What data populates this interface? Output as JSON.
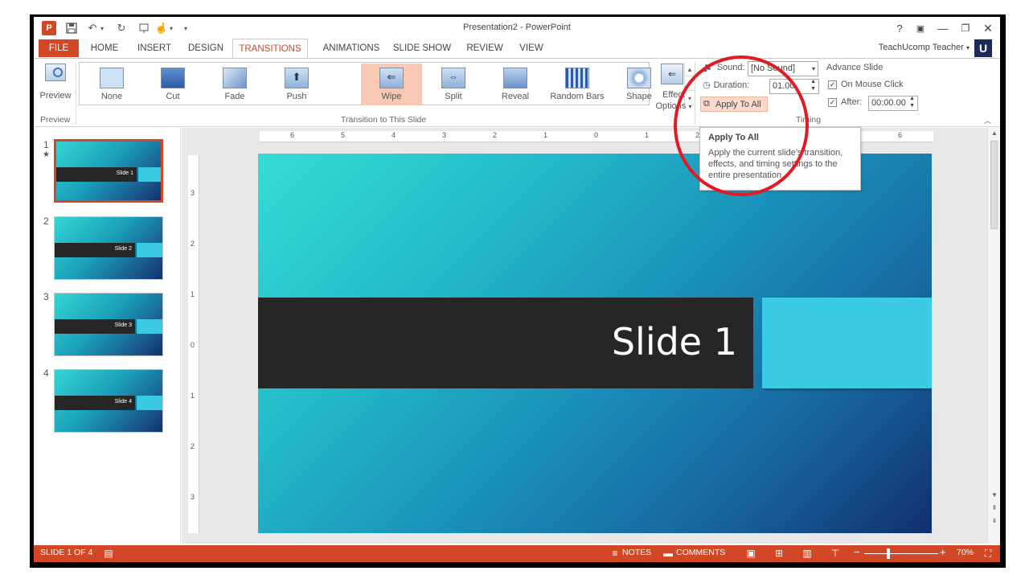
{
  "window": {
    "title": "Presentation2 - PowerPoint",
    "app_icon": "P",
    "controls": [
      "?",
      "▣",
      "—",
      "❐",
      "✕"
    ]
  },
  "quick_access": {
    "save": "save-icon",
    "undo": "undo-icon",
    "redo": "redo-icon",
    "start": "slideshow-icon",
    "touch": "touch-icon",
    "customize": "▾"
  },
  "tabs": [
    "FILE",
    "HOME",
    "INSERT",
    "DESIGN",
    "TRANSITIONS",
    "ANIMATIONS",
    "SLIDE SHOW",
    "REVIEW",
    "VIEW"
  ],
  "user": {
    "name": "TeachUcomp Teacher",
    "badge": "U"
  },
  "ribbon": {
    "preview": {
      "label": "Preview",
      "group": "Preview"
    },
    "transitions": {
      "items": [
        "None",
        "Cut",
        "Fade",
        "Push",
        "Wipe",
        "Split",
        "Reveal",
        "Random Bars",
        "Shape"
      ],
      "selected": "Wipe",
      "group": "Transition to This Slide"
    },
    "effect_options": {
      "line1": "Effect",
      "line2": "Options"
    },
    "timing": {
      "group": "Timing",
      "sound_label": "Sound:",
      "sound_value": "[No Sound]",
      "duration_label": "Duration:",
      "duration_value": "01.00",
      "apply_all": "Apply To All",
      "advance_label": "Advance Slide",
      "on_mouse_click": "On Mouse Click",
      "after_label": "After:",
      "after_value": "00:00.00"
    }
  },
  "tooltip": {
    "title": "Apply To All",
    "body": "Apply the current slide's transition, effects, and timing settings to the entire presentation."
  },
  "slides": [
    {
      "num": "1",
      "label": "Slide 1",
      "selected": true
    },
    {
      "num": "2",
      "label": "Slide 2",
      "selected": false
    },
    {
      "num": "3",
      "label": "Slide 3",
      "selected": false
    },
    {
      "num": "4",
      "label": "Slide 4",
      "selected": false
    }
  ],
  "slide_star": "★",
  "current_slide": {
    "title": "Slide 1"
  },
  "ruler": {
    "h": [
      "6",
      "5",
      "4",
      "3",
      "2",
      "1",
      "0",
      "1",
      "2",
      "3",
      "4",
      "5",
      "6"
    ],
    "v": [
      "3",
      "2",
      "1",
      "0",
      "1",
      "2",
      "3"
    ]
  },
  "status": {
    "slide_of": "SLIDE 1 OF 4",
    "notes": "NOTES",
    "comments": "COMMENTS",
    "zoom": "70%",
    "zoom_level_percent": 70
  },
  "colors": {
    "accent": "#d24726",
    "slide_dark": "#262626",
    "slide_block": "#3ccbe4",
    "highlight": "#e11b22"
  }
}
